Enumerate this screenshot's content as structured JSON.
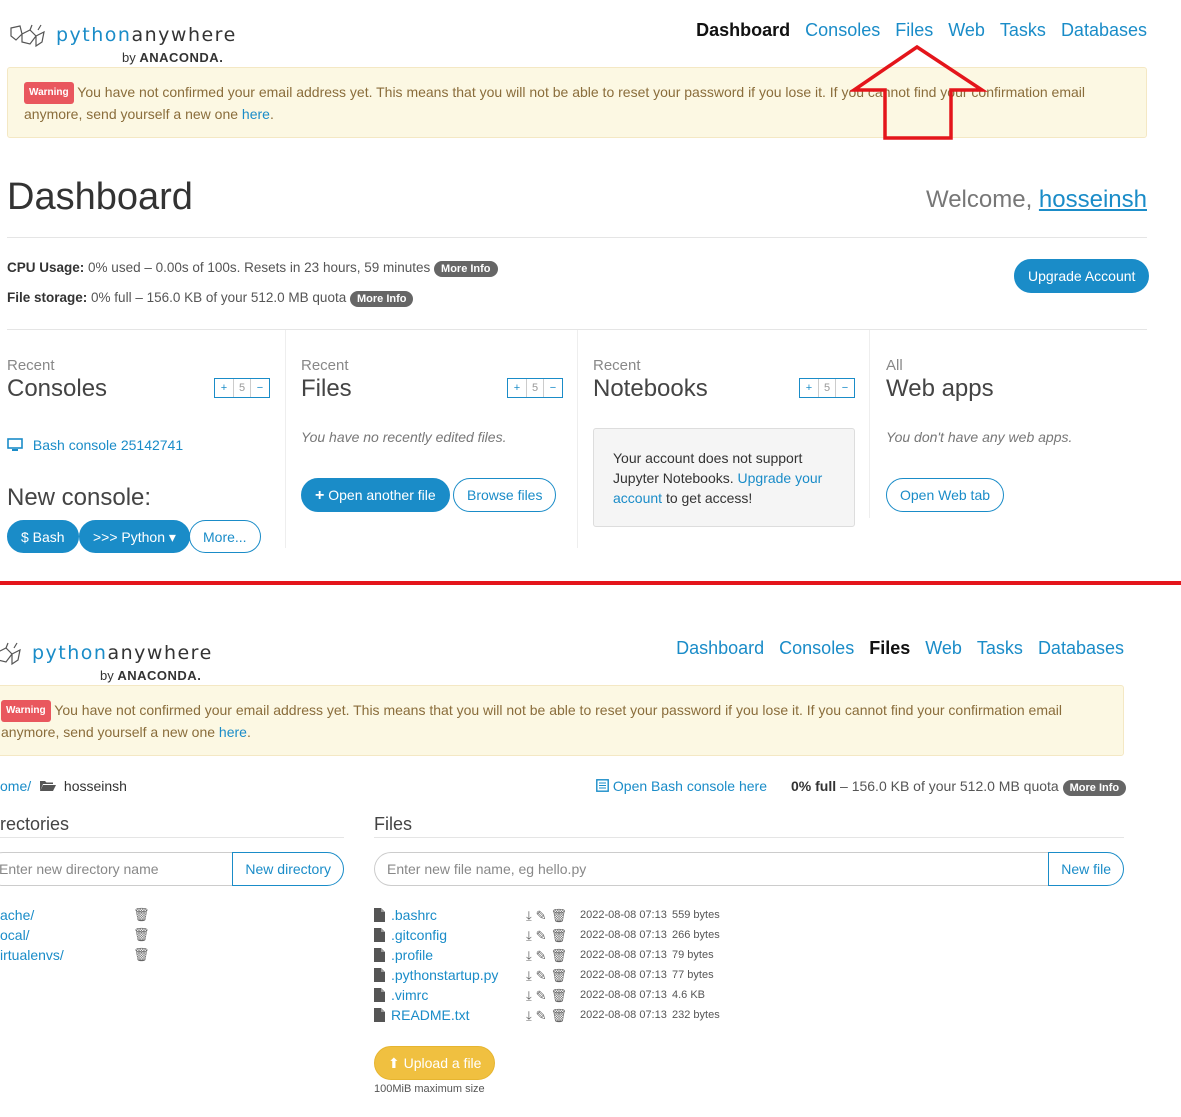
{
  "brand": {
    "python": "python",
    "anywhere": "anywhere",
    "by": "by",
    "anaconda": "ANACONDA."
  },
  "dashboard": {
    "nav": [
      "Dashboard",
      "Consoles",
      "Files",
      "Web",
      "Tasks",
      "Databases"
    ],
    "warning": {
      "badge": "Warning",
      "text": "You have not confirmed your email address yet. This means that you will not be able to reset your password if you lose it. If you cannot find your confirmation email anymore, send yourself a new one",
      "link": "here",
      "end": "."
    },
    "title": "Dashboard",
    "welcome": "Welcome,",
    "username": "hosseinsh",
    "cpu": {
      "label": "CPU Usage:",
      "value": "0% used – 0.00s of 100s. Resets in 23 hours, 59 minutes",
      "more": "More Info"
    },
    "storage": {
      "label": "File storage:",
      "value": "0% full – 156.0 KB of your 512.0 MB quota",
      "more": "More Info"
    },
    "upgrade": "Upgrade Account",
    "consoles": {
      "small": "Recent",
      "title": "Consoles",
      "count": "5",
      "item": "Bash console 25142741",
      "new": "New console:",
      "bash": "$ Bash",
      "python": ">>> Python ▾",
      "more": "More..."
    },
    "files": {
      "small": "Recent",
      "title": "Files",
      "count": "5",
      "empty": "You have no recently edited files.",
      "open": "Open another file",
      "browse": "Browse files"
    },
    "notebooks": {
      "small": "Recent",
      "title": "Notebooks",
      "count": "5",
      "note_pre": "Your account does not support Jupyter Notebooks.",
      "note_link": "Upgrade your account",
      "note_post": "to get access!"
    },
    "webapps": {
      "small": "All",
      "title": "Web apps",
      "empty": "You don't have any web apps.",
      "open": "Open Web tab"
    }
  },
  "files_page": {
    "nav": [
      "Dashboard",
      "Consoles",
      "Files",
      "Web",
      "Tasks",
      "Databases"
    ],
    "warning": {
      "badge": "Warning",
      "text": "You have not confirmed your email address yet. This means that you will not be able to reset your password if you lose it. If you cannot find your confirmation email anymore, send yourself a new one",
      "link": "here",
      "end": "."
    },
    "breadcrumb_home": "ome/",
    "breadcrumb_dir": "hosseinsh",
    "bash_here": "Open Bash console here",
    "quota_bold": "0% full",
    "quota_rest": "– 156.0 KB of your 512.0 MB quota",
    "more": "More Info",
    "dirs_header": "rectories",
    "dir_placeholder": "Enter new directory name",
    "dir_button": "New directory",
    "dirs": [
      "ache/",
      "ocal/",
      "irtualenvs/"
    ],
    "files_header": "Files",
    "file_placeholder": "Enter new file name, eg hello.py",
    "file_button": "New file",
    "files": [
      {
        "name": ".bashrc",
        "date": "2022-08-08 07:13",
        "size": "559 bytes"
      },
      {
        "name": ".gitconfig",
        "date": "2022-08-08 07:13",
        "size": "266 bytes"
      },
      {
        "name": ".profile",
        "date": "2022-08-08 07:13",
        "size": "79 bytes"
      },
      {
        "name": ".pythonstartup.py",
        "date": "2022-08-08 07:13",
        "size": "77 bytes"
      },
      {
        "name": ".vimrc",
        "date": "2022-08-08 07:13",
        "size": "4.6 KB"
      },
      {
        "name": "README.txt",
        "date": "2022-08-08 07:13",
        "size": "232 bytes"
      }
    ],
    "upload": "Upload a file",
    "upload_note": "100MiB maximum size"
  },
  "colors": {
    "accent": "#1a8cc8",
    "annotation": "#e4151b",
    "warning_bg": "#fcf8e3",
    "upload": "#f0c040"
  }
}
